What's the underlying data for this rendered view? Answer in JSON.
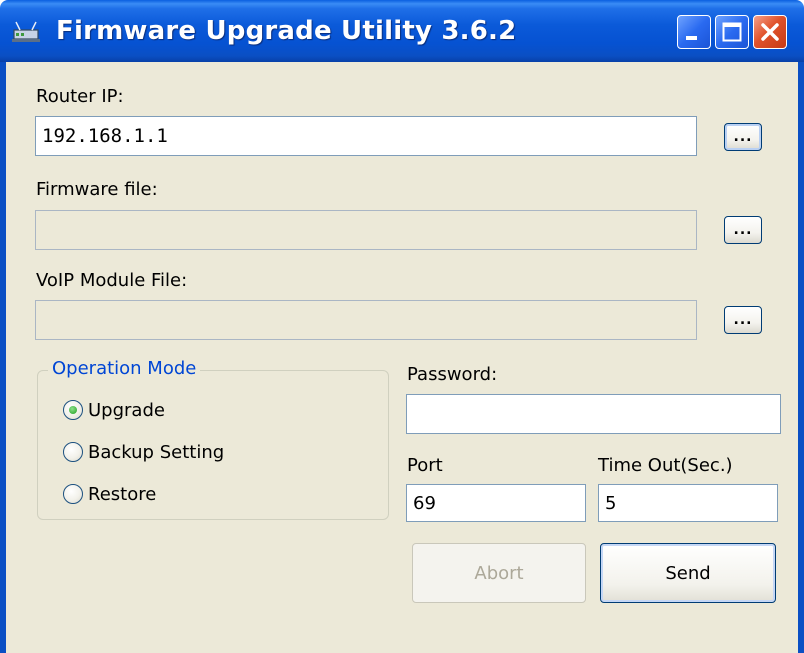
{
  "window": {
    "title": "Firmware Upgrade Utility 3.6.2",
    "controls": [
      "minimize-icon",
      "maximize-icon",
      "close-icon"
    ]
  },
  "router_ip": {
    "label": "Router IP:",
    "value": "192.168.1.1",
    "browse_label": "..."
  },
  "firmware_file": {
    "label": "Firmware file:",
    "value": "",
    "browse_label": "..."
  },
  "voip_module_file": {
    "label": "VoIP Module File:",
    "value": "",
    "browse_label": "..."
  },
  "operation_mode": {
    "legend": "Operation Mode",
    "options": [
      {
        "label": "Upgrade",
        "selected": true
      },
      {
        "label": "Backup Setting",
        "selected": false
      },
      {
        "label": "Restore",
        "selected": false
      }
    ]
  },
  "password": {
    "label": "Password:",
    "value": ""
  },
  "port": {
    "label": "Port",
    "value": "69"
  },
  "timeout": {
    "label": "Time Out(Sec.)",
    "value": "5"
  },
  "buttons": {
    "abort": "Abort",
    "send": "Send"
  },
  "colors": {
    "titlebar": "#0a4fc4",
    "client_bg": "#ece9d8",
    "group_legend": "#0046d5",
    "close_button": "#e0522a",
    "radio_selected": "#21a121"
  }
}
